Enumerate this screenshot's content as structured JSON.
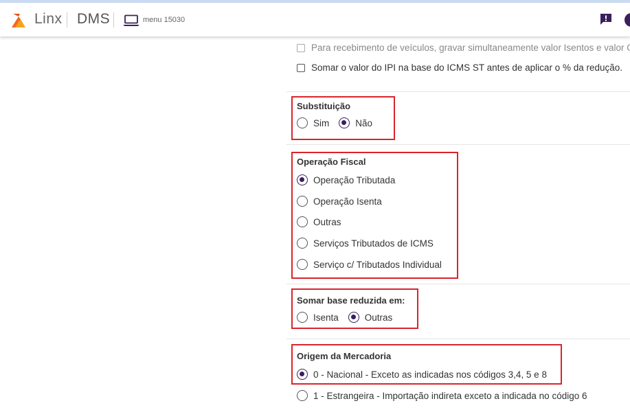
{
  "header": {
    "brand": "Linx",
    "product": "DMS",
    "menu_label": "menu 15030",
    "icons": {
      "logo": "linx-logo-icon",
      "laptop": "laptop-icon",
      "notification": "feedback-icon",
      "help": "help-icon"
    },
    "colors": {
      "accent": "#3a1f5c",
      "logo_orange": "#f06a1d",
      "highlight": "#d9242c"
    }
  },
  "checkboxes": [
    {
      "label": "Para recebimento de veículos, gravar simultaneamente valor Isentos e valor Ou",
      "checked": false
    },
    {
      "label": "Somar o valor do IPI na base do ICMS ST antes de aplicar o % da redução.",
      "checked": false
    }
  ],
  "substituicao": {
    "title": "Substituição",
    "options": [
      {
        "label": "Sim",
        "selected": false
      },
      {
        "label": "Não",
        "selected": true
      }
    ]
  },
  "operacao_fiscal": {
    "title": "Operação Fiscal",
    "options": [
      {
        "label": "Operação Tributada",
        "selected": true
      },
      {
        "label": "Operação Isenta",
        "selected": false
      },
      {
        "label": "Outras",
        "selected": false
      },
      {
        "label": "Serviços Tributados de ICMS",
        "selected": false
      },
      {
        "label": "Serviço c/ Tributados Individual",
        "selected": false
      }
    ]
  },
  "somar_base": {
    "title": "Somar base reduzida em:",
    "options": [
      {
        "label": "Isenta",
        "selected": false
      },
      {
        "label": "Outras",
        "selected": true
      }
    ]
  },
  "origem": {
    "title": "Origem da Mercadoria",
    "options": [
      {
        "label": "0 - Nacional - Exceto as indicadas nos códigos 3,4, 5 e 8",
        "selected": true
      },
      {
        "label": "1 - Estrangeira - Importação indireta exceto a indicada no código 6",
        "selected": false
      }
    ]
  }
}
